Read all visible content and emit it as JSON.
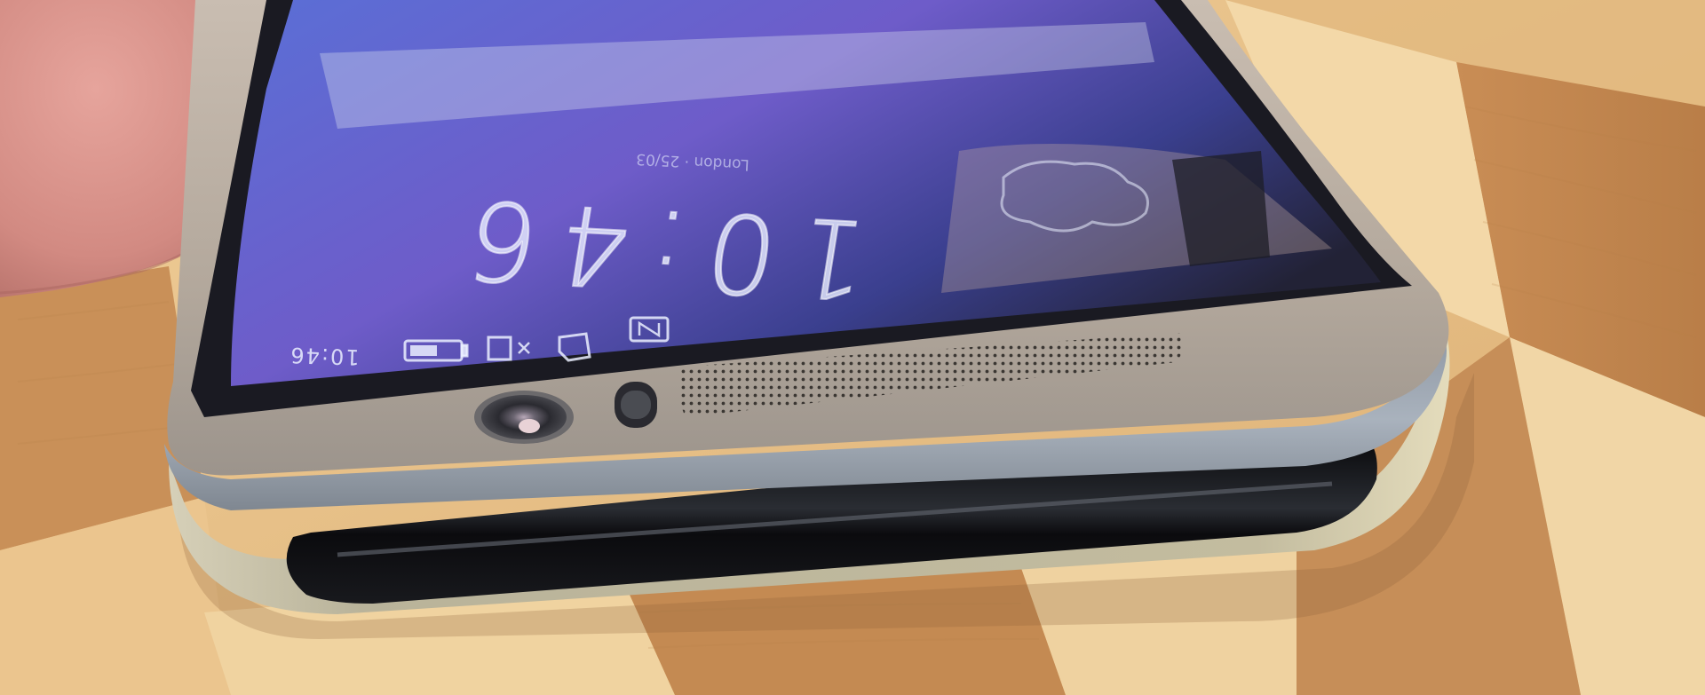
{
  "photo": {
    "subject": "smartphone-top-edge-closeup",
    "colors": {
      "background_wood_light": "#e8c590",
      "background_wood_dark": "#c8925a",
      "finger_skin": "#d98c84",
      "phone_body_gold": "#b9ada0",
      "phone_bezel_silver": "#9ea6b0",
      "screen_blue": "#4f5fc8",
      "screen_purple": "#6b57c4",
      "glass_black": "#101014"
    }
  },
  "screen": {
    "clock": "10:46",
    "location_date": "London · 25/03",
    "status_bar_time": "10:46"
  },
  "icons": {
    "battery": "battery-icon",
    "signal": "signal-icon",
    "sd_card": "sd-card-icon",
    "nfc": "nfc-icon",
    "front_camera": "front-camera-icon",
    "sensor": "proximity-sensor-icon",
    "speaker": "speaker-grille-icon"
  }
}
